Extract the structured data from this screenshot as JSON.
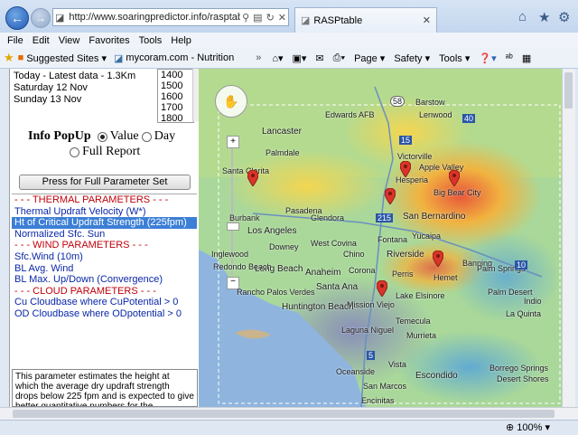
{
  "browser": {
    "url": "http://www.soaringpredictor.info/rasptabl",
    "tab_title": "RASPtable",
    "zoom": "100%",
    "menu": [
      "File",
      "Edit",
      "View",
      "Favorites",
      "Tools",
      "Help"
    ],
    "favorites": [
      "Suggested Sites ▾",
      "mycoram.com - Nutrition"
    ],
    "commands": [
      "Page ▾",
      "Safety ▾",
      "Tools ▾"
    ]
  },
  "forecast": {
    "days": [
      "Today - Latest data - 1.3Km",
      "Saturday 12 Nov",
      "Sunday 13 Nov"
    ],
    "times": [
      "1400",
      "1500",
      "1600",
      "1700",
      "1800"
    ],
    "popup_title": "Info PopUp",
    "popup_options": [
      "Value",
      "Day",
      "Full Report"
    ],
    "popup_selected": "Value",
    "full_param_button": "Press for Full Parameter Set"
  },
  "parameters": [
    {
      "label": "- - - THERMAL PARAMETERS - - -",
      "type": "header"
    },
    {
      "label": "Thermal Updraft Velocity (W*)",
      "type": "item"
    },
    {
      "label": "Ht of Critical Updraft Strength (225fpm)",
      "type": "selected"
    },
    {
      "label": "Normalized Sfc. Sun",
      "type": "item"
    },
    {
      "label": "- - - WIND PARAMETERS - - -",
      "type": "header"
    },
    {
      "label": "Sfc.Wind (10m)",
      "type": "item"
    },
    {
      "label": "BL Avg. Wind",
      "type": "item"
    },
    {
      "label": "BL Max. Up/Down (Convergence)",
      "type": "item"
    },
    {
      "label": "- - - CLOUD PARAMETERS - - -",
      "type": "header"
    },
    {
      "label": "Cu Cloudbase where CuPotential > 0",
      "type": "item"
    },
    {
      "label": "OD Cloudbase where ODpotential > 0",
      "type": "item"
    }
  ],
  "description": "This parameter estimates the height at which the average dry updraft strength drops below 225 fpm and is expected to give better quantitative numbers for the",
  "map_labels": {
    "top": [
      "Barstow",
      "Lenwood",
      "Hesperia",
      "Apple Valley",
      "Victorville",
      "Edwards AFB",
      "Lancaster",
      "Palmdale",
      "Big Bear City",
      "Santa Clarita"
    ],
    "mid": [
      "Glendora",
      "Pasadena",
      "San Bernardino",
      "Burbank",
      "Los Angeles",
      "Fontana",
      "Yucaipa",
      "West Covina",
      "Downey",
      "Chino",
      "Riverside",
      "Inglewood",
      "Long Beach",
      "Anaheim",
      "Redondo Beach",
      "Banning",
      "Palm Springs",
      "Corona",
      "Perris",
      "Hemet"
    ],
    "low": [
      "Santa Ana",
      "Rancho Palos Verdes",
      "Huntington Beach",
      "Mission Viejo",
      "Lake Elsinore",
      "Palm Desert",
      "Indio",
      "La Quinta",
      "Temecula",
      "Laguna Niguel",
      "Oceanside",
      "Vista",
      "Escondido",
      "Borrego Springs",
      "San Marcos",
      "Desert Shores",
      "Encinitas",
      "Murrieta"
    ],
    "highways": [
      "58",
      "15",
      "40",
      "10",
      "215",
      "5"
    ]
  },
  "colors": {
    "accent": "#3c7fd6",
    "header_red": "#c0000a",
    "item_blue": "#0a27a8",
    "pin": "#d9342b"
  }
}
